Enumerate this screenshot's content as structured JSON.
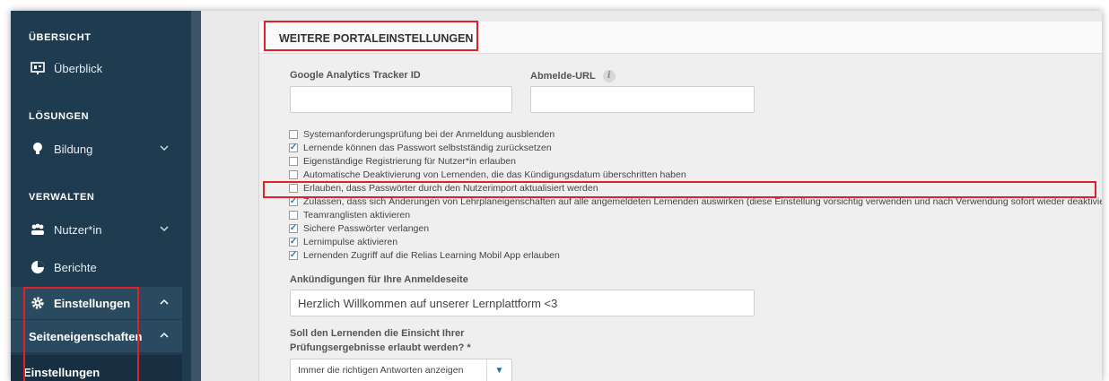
{
  "sidebar": {
    "section_overview": "ÜBERSICHT",
    "item_overview": "Überblick",
    "section_solutions": "LÖSUNGEN",
    "item_education": "Bildung",
    "section_manage": "VERWALTEN",
    "item_users": "Nutzer*in",
    "item_reports": "Berichte",
    "item_settings": "Einstellungen",
    "sub_site_properties": "Seiteneigenschaften",
    "sub_settings": "Einstellungen"
  },
  "panel": {
    "title": "WEITERE PORTALEINSTELLUNGEN",
    "ga_label": "Google Analytics Tracker ID",
    "ga_value": "",
    "logout_label": "Abmelde-URL",
    "logout_value": "",
    "options": [
      {
        "label": "Systemanforderungsprüfung bei der Anmeldung ausblenden",
        "checked": false
      },
      {
        "label": "Lernende können das Passwort selbstständig zurücksetzen",
        "checked": true
      },
      {
        "label": "Eigenständige Registrierung für Nutzer*in erlauben",
        "checked": false
      },
      {
        "label": "Automatische Deaktivierung von Lernenden, die das Kündigungsdatum überschritten haben",
        "checked": false
      },
      {
        "label": "Erlauben, dass Passwörter durch den Nutzerimport aktualisiert werden",
        "checked": false
      },
      {
        "label": "Zulassen, dass sich Änderungen von Lehrplaneigenschaften auf alle angemeldeten Lernenden auswirken (diese Einstellung vorsichtig verwenden und nach Verwendung sofort wieder deaktivieren)",
        "checked": true
      },
      {
        "label": "Teamranglisten aktivieren",
        "checked": false
      },
      {
        "label": "Sichere Passwörter verlangen",
        "checked": true
      },
      {
        "label": "Lernimpulse aktivieren",
        "checked": true
      },
      {
        "label": "Lernenden Zugriff auf die Relias Learning Mobil App erlauben",
        "checked": true
      }
    ],
    "announcement_label": "Ankündigungen für Ihre Anmeldeseite",
    "announcement_value": "Herzlich Willkommen auf unserer Lernplattform <3",
    "exam_label_line1": "Soll den Lernenden die Einsicht Ihrer",
    "exam_label_line2": "Prüfungsergebnisse erlaubt werden? *",
    "exam_select_value": "Immer die richtigen Antworten anzeigen"
  },
  "colors": {
    "sidebar_bg": "#1f3b4f",
    "highlight_red": "#e0202b",
    "checkbox_blue": "#2a7ab8"
  }
}
